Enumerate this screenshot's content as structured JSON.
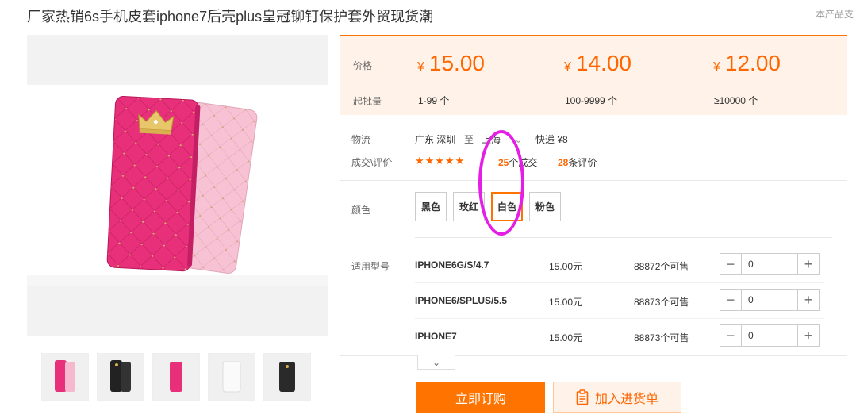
{
  "product": {
    "title": "厂家热销6s手机皮套iphone7后壳plus皇冠铆钉保护套外贸现货潮",
    "support_note": "本产品支"
  },
  "gallery": {
    "thumbnails": [
      {
        "name": "thumb-rose-pink"
      },
      {
        "name": "thumb-black"
      },
      {
        "name": "thumb-rose"
      },
      {
        "name": "thumb-white"
      },
      {
        "name": "thumb-black-2"
      }
    ]
  },
  "pricing": {
    "price_label": "价格",
    "moq_label": "起批量",
    "currency": "¥",
    "tiers": [
      {
        "price": "15.00",
        "range": "1-99 个"
      },
      {
        "price": "14.00",
        "range": "100-9999 个"
      },
      {
        "price": "12.00",
        "range": "≥10000 个"
      }
    ],
    "accent": "#ff6600"
  },
  "logistics": {
    "label": "物流",
    "from": "广东 深圳",
    "to_word": "至",
    "destination": "上海",
    "shipping": "快递 ¥8"
  },
  "deals": {
    "label": "成交\\评价",
    "rating": 5,
    "stars": "★★★★★",
    "sold_count": "25",
    "sold_suffix": "个成交",
    "review_count": "28",
    "review_suffix": "条评价"
  },
  "colors": {
    "label": "颜色",
    "options": [
      "黑色",
      "玫红",
      "白色",
      "粉色"
    ],
    "selected": "白色"
  },
  "models": {
    "label": "适用型号",
    "rows": [
      {
        "name": "IPHONE6G/S/4.7",
        "price": "15.00元",
        "stock": "88872个可售",
        "qty": "0"
      },
      {
        "name": "IPHONE6/SPLUS/5.5",
        "price": "15.00元",
        "stock": "88873个可售",
        "qty": "0"
      },
      {
        "name": "IPHONE7",
        "price": "15.00元",
        "stock": "88873个可售",
        "qty": "0"
      }
    ]
  },
  "actions": {
    "order": "立即订购",
    "add_to_list": "加入进货单"
  },
  "icons": {
    "expand": "chevron-down-icon",
    "cart": "clipboard-list-icon",
    "minus": "minus-icon",
    "plus": "plus-icon"
  }
}
